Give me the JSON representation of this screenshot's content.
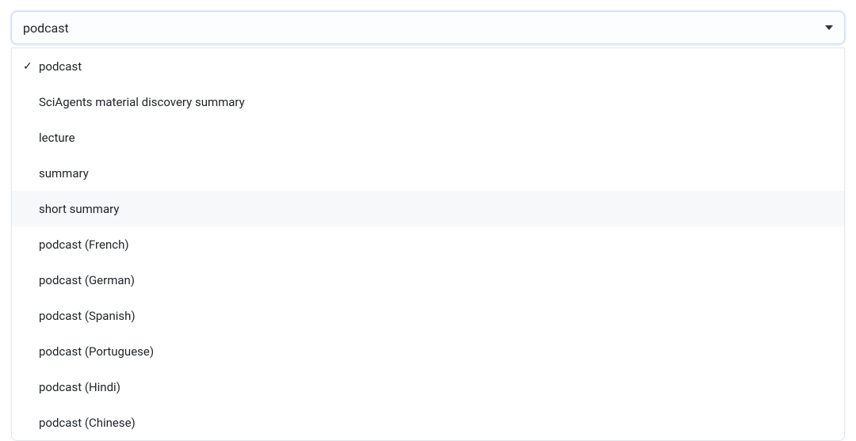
{
  "combobox": {
    "value": "podcast",
    "options": [
      {
        "label": "podcast",
        "selected": true,
        "hover": false
      },
      {
        "label": "SciAgents material discovery summary",
        "selected": false,
        "hover": false
      },
      {
        "label": "lecture",
        "selected": false,
        "hover": false
      },
      {
        "label": "summary",
        "selected": false,
        "hover": false
      },
      {
        "label": "short summary",
        "selected": false,
        "hover": true
      },
      {
        "label": "podcast (French)",
        "selected": false,
        "hover": false
      },
      {
        "label": "podcast (German)",
        "selected": false,
        "hover": false
      },
      {
        "label": "podcast (Spanish)",
        "selected": false,
        "hover": false
      },
      {
        "label": "podcast (Portuguese)",
        "selected": false,
        "hover": false
      },
      {
        "label": "podcast (Hindi)",
        "selected": false,
        "hover": false
      },
      {
        "label": "podcast (Chinese)",
        "selected": false,
        "hover": false
      }
    ]
  },
  "icons": {
    "check": "✓"
  }
}
